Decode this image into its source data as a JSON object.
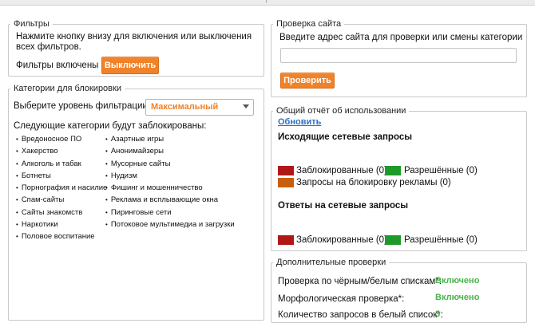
{
  "filters": {
    "title": "Фильтры",
    "description_line1": "Нажмите кнопку внизу для включения или выключения",
    "description_line2": "всех фильтров.",
    "status": "Фильтры включены",
    "button": "Выключить"
  },
  "categories": {
    "title": "Категории для блокировки",
    "level_label": "Выберите уровень фильтрации:",
    "level_value": "Максимальный",
    "blocked_heading": "Следующие категории будут заблокированы:",
    "col1": [
      "Вредоносное ПО",
      "Хакерство",
      "Алкоголь и табак",
      "Ботнеты",
      "Порнография и насилие",
      "Спам-сайты",
      "Сайты знакомств",
      "Наркотики",
      "Половое воспитание"
    ],
    "col2": [
      "Азартные игры",
      "Анонимайзеры",
      "Мусорные сайты",
      "Нудизм",
      "Фишинг и мошенничество",
      "Реклама и всплывающие окна",
      "Пиринговые сети",
      "Потоковое мультимедиа и загрузки"
    ]
  },
  "site_check": {
    "title": "Проверка сайта",
    "prompt": "Введите адрес сайта для проверки или смены категории",
    "input_value": "",
    "button": "Проверить"
  },
  "usage": {
    "title": "Общий отчёт об использовании",
    "refresh": "Обновить",
    "outgoing_heading": "Исходящие сетевые запросы",
    "blocked_out": "Заблокированные (0)",
    "allowed_out": "Разрешённые (0)",
    "ads_blocked": "Запросы на блокировку рекламы (0)",
    "responses_heading": "Ответы на сетевые запросы",
    "blocked_resp": "Заблокированные (0)",
    "allowed_resp": "Разрешённые (0)",
    "colors": {
      "blocked": "#b01818",
      "allowed": "#1e9a2a",
      "ads": "#c85f0d"
    }
  },
  "extra": {
    "title": "Дополнительные проверки",
    "row1_label": "Проверка по чёрным/белым спискам*:",
    "row1_value": "Включено",
    "row2_label": "Морфологическая проверка*:",
    "row2_value": "Включено",
    "row3_label": "Количество запросов в белый список*:",
    "row3_value": "3"
  },
  "colors": {
    "accent": "#f0822a",
    "link": "#2a6fc4",
    "enabled": "#47b54a"
  }
}
